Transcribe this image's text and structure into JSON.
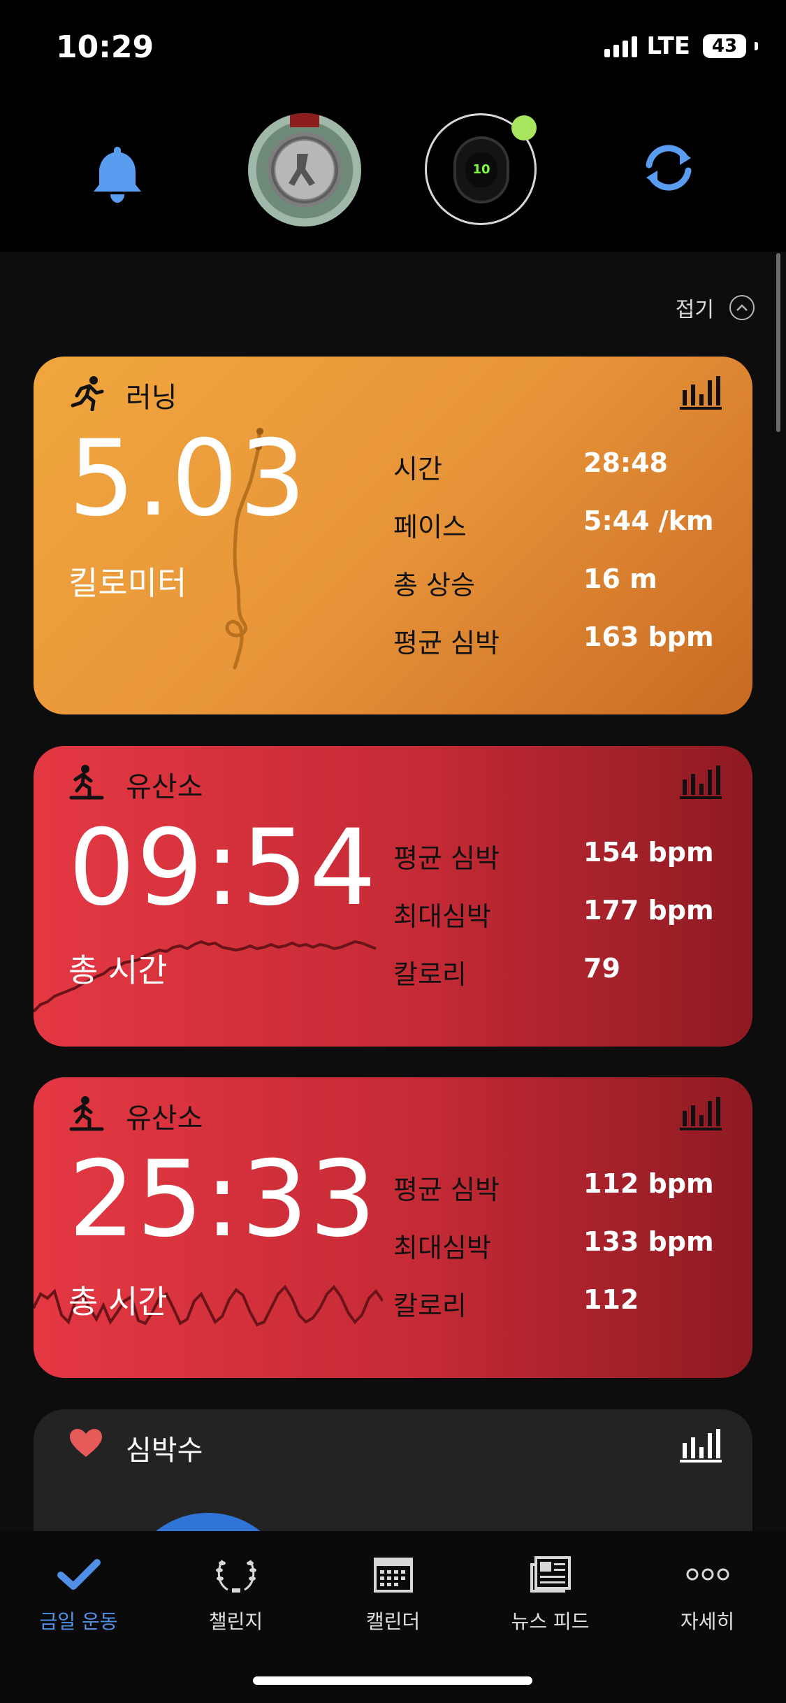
{
  "status_bar": {
    "time": "10:29",
    "network": "LTE",
    "battery": "43"
  },
  "top": {
    "colors": {
      "bell": "#5a9cf0",
      "sync": "#5a9cf0",
      "device_status": "#a7e65e"
    },
    "watch_display": "10"
  },
  "collapse_label": "접기",
  "cards": [
    {
      "title": "러닝",
      "big_value": "5.03",
      "big_unit": "킬로미터",
      "stats": [
        {
          "label": "시간",
          "value": "28:48"
        },
        {
          "label": "페이스",
          "value": "5:44 /km"
        },
        {
          "label": "총 상승",
          "value": "16 m"
        },
        {
          "label": "평균 심박",
          "value": "163 bpm"
        }
      ]
    },
    {
      "title": "유산소",
      "big_value": "09:54",
      "big_unit": "총 시간",
      "stats": [
        {
          "label": "평균 심박",
          "value": "154 bpm"
        },
        {
          "label": "최대심박",
          "value": "177 bpm"
        },
        {
          "label": "칼로리",
          "value": "79"
        }
      ]
    },
    {
      "title": "유산소",
      "big_value": "25:33",
      "big_unit": "총 시간",
      "stats": [
        {
          "label": "평균 심박",
          "value": "112 bpm"
        },
        {
          "label": "최대심박",
          "value": "133 bpm"
        },
        {
          "label": "칼로리",
          "value": "112"
        }
      ]
    },
    {
      "title": "심박수"
    }
  ],
  "tabs": [
    {
      "label": "금일 운동",
      "icon": "check-icon",
      "active": true
    },
    {
      "label": "챌린지",
      "icon": "laurel-icon",
      "active": false
    },
    {
      "label": "캘린더",
      "icon": "calendar-icon",
      "active": false
    },
    {
      "label": "뉴스 피드",
      "icon": "news-icon",
      "active": false
    },
    {
      "label": "자세히",
      "icon": "more-icon",
      "active": false
    }
  ],
  "colors": {
    "running": "#f0a63d",
    "cardio": "#e43843",
    "active_tab": "#4f8fe6"
  }
}
